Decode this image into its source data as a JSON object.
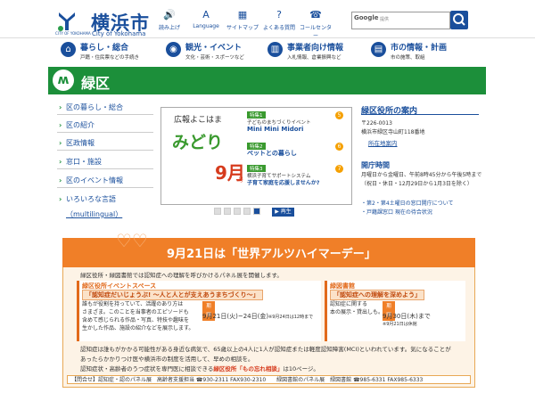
{
  "header": {
    "logo_sub": "CITY OF YOKOHAMA",
    "title": "横浜市",
    "title_en": "City of Yokohama",
    "utilities": [
      {
        "label": "読み上げ",
        "icon": "speaker-icon"
      },
      {
        "label": "Language",
        "icon": "globe-icon"
      },
      {
        "label": "サイトマップ",
        "icon": "sitemap-icon"
      },
      {
        "label": "よくある質問",
        "icon": "question-icon"
      },
      {
        "label": "コールセンター",
        "icon": "phone-icon"
      }
    ],
    "search_label": "Google",
    "search_placeholder": "提供",
    "search_icon": "magnifier-icon"
  },
  "global_nav": [
    {
      "title": "暮らし・総合",
      "sub": "戸籍・住民票などの手続き",
      "icon": "home-icon"
    },
    {
      "title": "観光・イベント",
      "sub": "文化・芸術・スポーツなど",
      "icon": "camera-icon"
    },
    {
      "title": "事業者向け情報",
      "sub": "入札情報、倉業振興など",
      "icon": "building-icon"
    },
    {
      "title": "市の情報・計画",
      "sub": "市の施策、取組",
      "icon": "document-icon"
    }
  ],
  "ward": {
    "name": "緑区",
    "emblem_icon": "ward-emblem-icon"
  },
  "side_nav": [
    {
      "label": "区の暮らし・総合"
    },
    {
      "label": "区の紹介"
    },
    {
      "label": "区政情報"
    },
    {
      "label": "窓口・施設"
    },
    {
      "label": "区のイベント情報"
    },
    {
      "label": "いろいろな言語"
    }
  ],
  "side_nav_multilingual": "（multilingual）",
  "promo": {
    "kicker": "広報よこはま",
    "name": "みどり",
    "month": "9月",
    "month_suffix": "号",
    "features": [
      {
        "tag": "特集1",
        "lead": "子どものまちづくりイベント",
        "headline": "Mini Mini Midori",
        "num": "5"
      },
      {
        "tag": "特集2",
        "lead": "",
        "headline": "ペットとの暮らし",
        "num": "6"
      },
      {
        "tag": "特集3",
        "lead": "横浜子育てサポートシステム",
        "headline": "子育て家庭を応援しませんか?",
        "num": "7"
      }
    ],
    "play_label": "▶ 再生"
  },
  "office": {
    "title": "緑区役所の案内",
    "zip": "〒226-0013",
    "address": "横浜市緑区寺山町118番地",
    "map_link": "所在地案内",
    "hours_title": "開庁時間",
    "hours_text": "月曜日から金曜日、午前8時45分から午後5時まで（祝日・休日・12月29日から1月3日を除く）",
    "link1": "・第2・第4土曜日の窓口開庁について",
    "link2": "・戸籍課窓口 現在の待合状況"
  },
  "event": {
    "title": "9月21日は「世界アルツハイマーデー」",
    "intro": "緑区役所・緑図書館では認知症への理解を呼びかけるパネル展を開催します。",
    "left_heading": "緑区役所イベントスペース",
    "left_title": "「認知症だいじょうぶ! ～人と人とが支えあうまちづくり～」",
    "left_p1": "誰もが役割を持っていて、活躍のあり方は",
    "left_p2": "さまざま。このことを当事者のエピソードも",
    "left_p3": "含めて感じられる作品・写真、特技や趣味を",
    "left_p4": "生かした作品、施設の紹介などを展示します。",
    "left_period_label": "期間",
    "left_period": "9月21日(火)~24日(金)",
    "left_period_note": "※9月24日は12時まで",
    "right_heading": "緑図書館",
    "right_title": "「認知症への理解を深めよう」",
    "right_p1": "認知症に関する",
    "right_p2": "本の展示・貸出しも。",
    "right_period_label": "期間",
    "right_period": "9月30日(木)まで",
    "right_period_note": "※9月21日は休館",
    "body1": "認知症は誰もがかかる可能性がある身近な病気で、65歳以上の4人に1人が認知症または軽度認知障害(MCI)といわれています。気になることが",
    "body2": "あったらかかりつけ医や横浜市の制度を活用して、早めの相談を。",
    "body3a": "認知症状・高齢者のうつ症状を専門医に相談できる",
    "body3b": "緑区役所「もの忘れ相談」",
    "body3c": "は10ページ。",
    "contact": "【問合せ】認知症・認のパネル展　高齢者支援担当 ☎930-2311 FAX930-2310　　緑図書館のパネル展　緑図書館 ☎985-6331 FAX985-6333"
  },
  "colors": {
    "primary": "#1a4f9c",
    "ward_green": "#1c8f3a",
    "event_orange": "#f07f28"
  }
}
